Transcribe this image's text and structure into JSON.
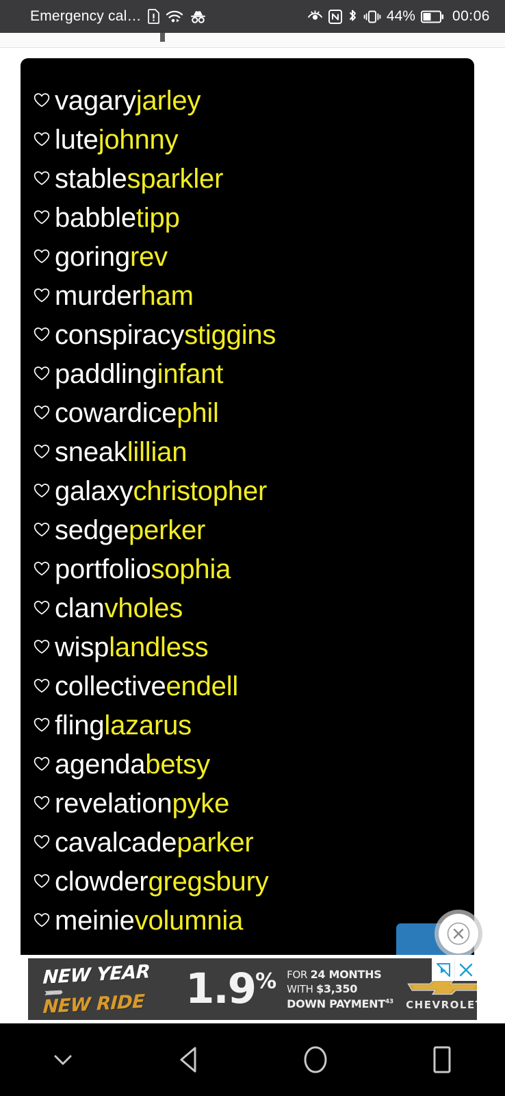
{
  "status_bar": {
    "carrier_text": "Emergency cal…",
    "battery_percent": "44%",
    "clock": "00:06",
    "left_icons": [
      "sim-card-alert-icon",
      "wifi-icon",
      "incognito-icon"
    ],
    "right_icons": [
      "eye-comfort-icon",
      "nfc-icon",
      "bluetooth-icon",
      "vibrate-icon",
      "battery-icon"
    ]
  },
  "card": {
    "background_color": "#000000",
    "prefix_color": "#ffffff",
    "suffix_color": "#f2ed24",
    "items": [
      {
        "prefix": "vagary",
        "suffix": "jarley"
      },
      {
        "prefix": "lute",
        "suffix": "johnny"
      },
      {
        "prefix": "stable",
        "suffix": "sparkler"
      },
      {
        "prefix": "babble",
        "suffix": "tipp"
      },
      {
        "prefix": "goring",
        "suffix": "rev"
      },
      {
        "prefix": "murder",
        "suffix": "ham"
      },
      {
        "prefix": "conspiracy",
        "suffix": "stiggins"
      },
      {
        "prefix": "paddling",
        "suffix": "infant"
      },
      {
        "prefix": "cowardice",
        "suffix": "phil"
      },
      {
        "prefix": "sneak",
        "suffix": "lillian"
      },
      {
        "prefix": "galaxy",
        "suffix": "christopher"
      },
      {
        "prefix": "sedge",
        "suffix": "perker"
      },
      {
        "prefix": "portfolio",
        "suffix": "sophia"
      },
      {
        "prefix": "clan",
        "suffix": "vholes"
      },
      {
        "prefix": "wisp",
        "suffix": "landless"
      },
      {
        "prefix": "collective",
        "suffix": "endell"
      },
      {
        "prefix": "fling",
        "suffix": "lazarus"
      },
      {
        "prefix": "agenda",
        "suffix": "betsy"
      },
      {
        "prefix": "revelation",
        "suffix": "pyke"
      },
      {
        "prefix": "cavalcade",
        "suffix": "parker"
      },
      {
        "prefix": "clowder",
        "suffix": "gregsbury"
      },
      {
        "prefix": "meinie",
        "suffix": "volumnia"
      }
    ],
    "row_icon": "heart-outline-icon"
  },
  "overlay": {
    "close_icon": "close-circle-icon",
    "blue_button_color": "#2b7bba"
  },
  "ad": {
    "headline_top": "NEW YEAR",
    "headline_bottom": "NEW RIDE",
    "chevrons": "››››››››››››",
    "rate": "1.9",
    "rate_unit": "%",
    "term_line1_lead": "FOR ",
    "term_line1": "24 MONTHS",
    "term_line2_lead": "WITH ",
    "term_line2": "$3,350",
    "term_line3": "DOWN PAYMENT",
    "term_line3_sup": "43",
    "brand": "CHEVROLET",
    "brand_logo": "chevrolet-bowtie-icon",
    "adchoices_icon": "adchoices-icon",
    "close_icon": "close-x-icon",
    "background_color": "#3d3d3d",
    "accent_color": "#d99a2b",
    "control_color": "#1a9fd4"
  },
  "navbar": {
    "buttons": [
      {
        "name": "hide-keyboard-button",
        "icon": "chevron-down-icon"
      },
      {
        "name": "back-button",
        "icon": "back-triangle-icon"
      },
      {
        "name": "home-button",
        "icon": "home-circle-icon"
      },
      {
        "name": "recents-button",
        "icon": "recents-square-icon"
      }
    ]
  }
}
